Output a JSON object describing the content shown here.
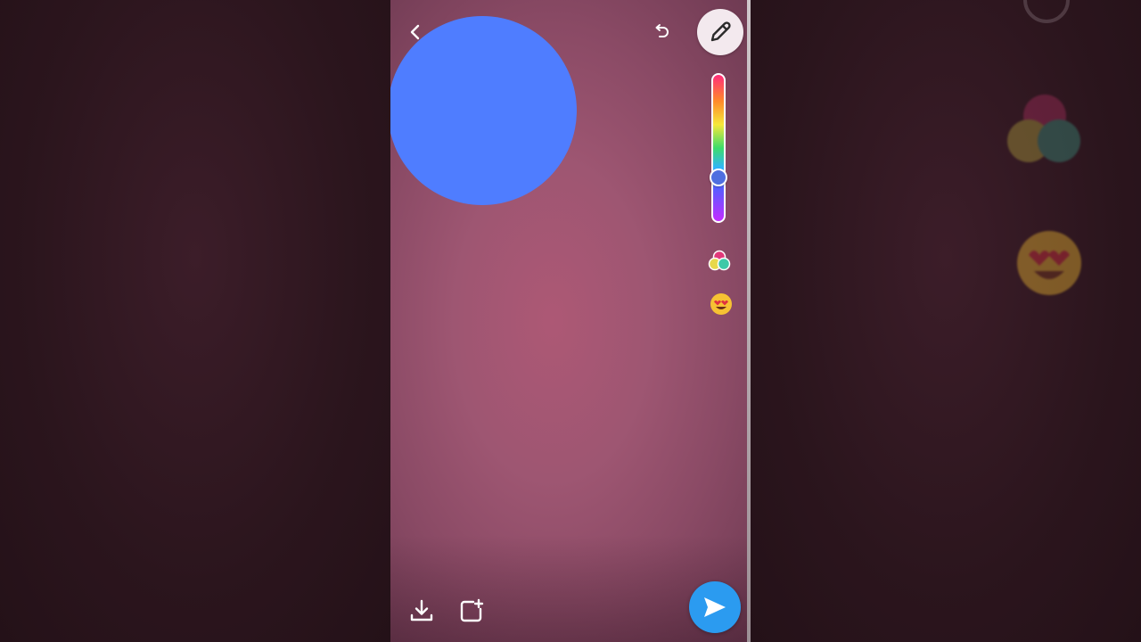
{
  "colors": {
    "drawn_circle": "#4f7dff",
    "slider_knob": "#4f6fe0",
    "send_button": "#2b9bf0"
  },
  "toolbar": {
    "back_icon": "chevron-left-icon",
    "undo_icon": "undo-icon",
    "pencil_icon": "pencil-icon"
  },
  "color_slider": {
    "selected_position_fraction": 0.73
  },
  "side_tools": {
    "palette_icon": "color-palette-icon",
    "emoji_icon": "heart-eyes-emoji-icon"
  },
  "bottom_bar": {
    "save_icon": "download-icon",
    "story_icon": "add-to-story-icon",
    "send_icon": "send-arrow-icon"
  }
}
